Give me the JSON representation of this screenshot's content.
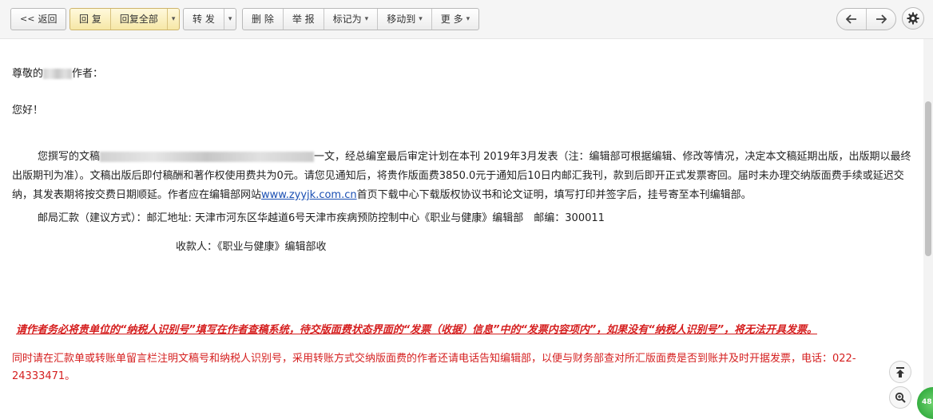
{
  "toolbar": {
    "back": "返回",
    "reply": "回 复",
    "reply_all": "回复全部",
    "forward": "转 发",
    "delete": "删 除",
    "report": "举 报",
    "mark_as": "标记为",
    "move_to": "移动到",
    "more": "更 多"
  },
  "mail": {
    "greeting_prefix": "尊敬的",
    "greeting_suffix": "作者：",
    "hello": "您好！",
    "para_prefix": "您撰写的文稿",
    "para_after_title": "一文，经总编室最后审定计划在本刊 2019年3月发表（注：编辑部可根据编辑、修改等情况，决定本文稿延期出版，出版期以最终出版期刊为准）。文稿出版后即付稿酬和著作权使用费共为0元。请您见通知后，将贵作版面费3850.0元于通知后10日内邮汇我刊，款到后即开正式发票寄回。届时未办理交纳版面费手续或延迟交纳，其发表期将按交费日期顺延。作者应在编辑部网站",
    "site_link": "www.zyyjk.com.cn",
    "para_after_link": "首页下载中心下载版权协议书和论文证明，填写打印并签字后，挂号寄至本刊编辑部。",
    "postal_line": "邮局汇款（建议方式）：邮汇地址: 天津市河东区华越道6号天津市疾病预防控制中心《职业与健康》编辑部　邮编：300011",
    "payee_line": "收款人：《职业与健康》编辑部收",
    "notice_bold": "请作者务必将贵单位的“纳税人识别号”填写在作者查稿系统，待交版面费状态界面的“发票（收据）信息”中的“发票内容项内”，如果没有“纳税人识别号”，将无法开具发票。",
    "notice_red": "同时请在汇款单或转账单留言栏注明文稿号和纳税人识别号，采用转账方式交纳版面费的作者还请电话告知编辑部，以便与财务部查对所汇版面费是否到账并及时开据发票，电话：022-24333471。"
  },
  "badge": "48",
  "colors": {
    "notice_red": "#d51f1f",
    "link_blue": "#1a4fb3",
    "badge_green": "#1f9f2f"
  }
}
